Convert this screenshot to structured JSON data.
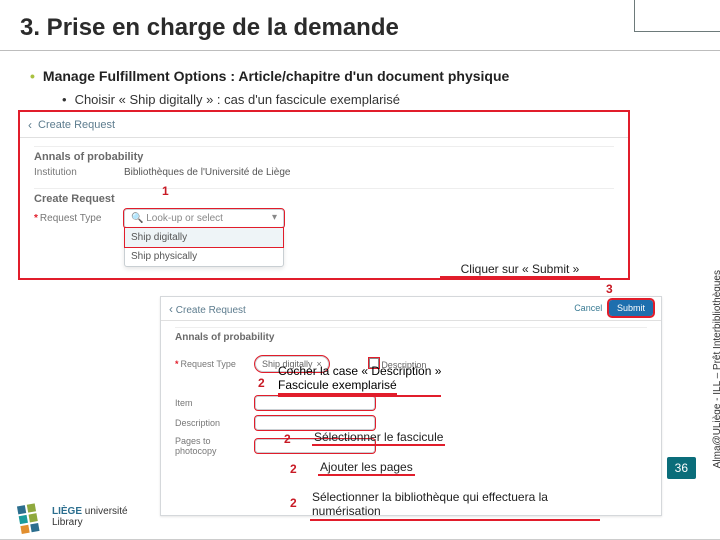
{
  "title": "3. Prise en charge de la demande",
  "bullet_main": "Manage Fulfillment Options : Article/chapitre d'un document physique",
  "bullet_sub": "Choisir « Ship digitally » : cas d'un fascicule exemplarisé",
  "side_text": "Alma@ULiège - ILL – Prêt Interbibliothèques",
  "page_number": "36",
  "logo": {
    "line1": "LIÈGE",
    "line2": "université",
    "line3": "Library"
  },
  "panel1": {
    "header": "Create Request",
    "section1": "Annals of probability",
    "institution_label": "Institution",
    "institution_value": "Bibliothèques de l'Université de Liège",
    "section2": "Create Request",
    "reqtype_label": "Request Type",
    "reqtype_placeholder": "Look-up or select",
    "option1": "Ship digitally",
    "option2": "Ship physically"
  },
  "panel2": {
    "header": "Create Request",
    "cancel": "Cancel",
    "submit": "Submit",
    "section1": "Annals of probability",
    "reqtype_label": "Request Type",
    "reqtype_value": "Ship digitally",
    "item_label": "Item",
    "desc_label": "Description",
    "pages_label": "Pages to photocopy"
  },
  "steps": {
    "s1": "1",
    "s2": "2",
    "s3": "3"
  },
  "annotations": {
    "submit": "Cliquer sur « Submit »",
    "desc_line1": "Cocher la case « Description »",
    "desc_line2": "Fascicule exemplarisé",
    "select_fasc": "Sélectionner le fascicule",
    "add_pages": "Ajouter les pages",
    "select_bib": "Sélectionner la bibliothèque qui effectuera la numérisation"
  }
}
